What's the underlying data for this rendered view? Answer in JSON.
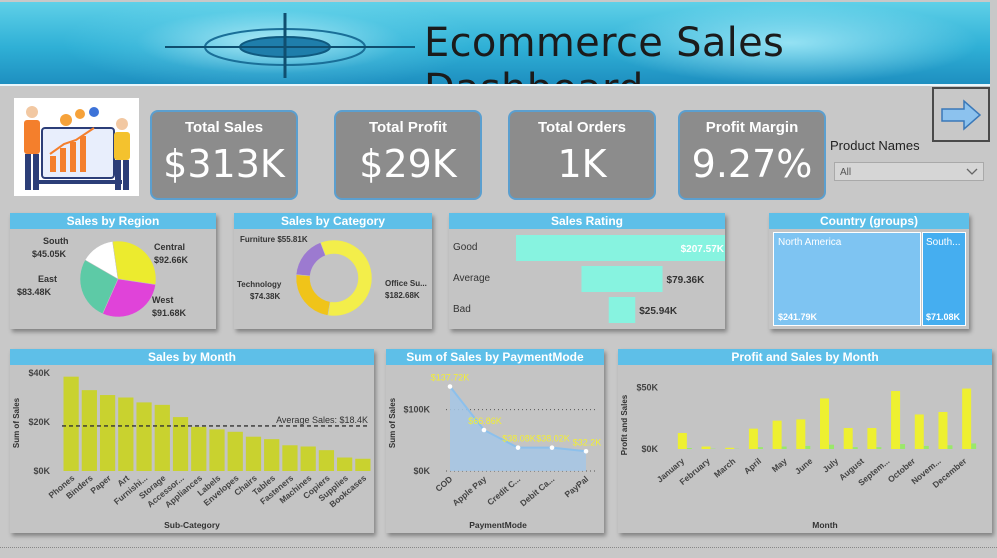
{
  "header": {
    "title": "Ecommerce Sales Dashboard"
  },
  "kpis": [
    {
      "label": "Total Sales",
      "value": "$313K"
    },
    {
      "label": "Total Profit",
      "value": "$29K"
    },
    {
      "label": "Total Orders",
      "value": "1K"
    },
    {
      "label": "Profit Margin",
      "value": "9.27%"
    }
  ],
  "filter": {
    "title": "Product Names",
    "value": "All"
  },
  "colors": {
    "accent": "#5ebfe8",
    "kpi_bg": "#8c8c8c",
    "bar_yellow": "#eef030",
    "bar_olive": "#c9d22f",
    "teal": "#87f3e0"
  },
  "region_chart": {
    "title": "Sales by Region",
    "slices": [
      {
        "name": "South",
        "value_label": "$45.05K",
        "value": 45.05,
        "color": "#ffffff"
      },
      {
        "name": "Central",
        "value_label": "$92.66K",
        "value": 92.66,
        "color": "#eceb2e"
      },
      {
        "name": "West",
        "value_label": "$91.68K",
        "value": 91.68,
        "color": "#e043d9"
      },
      {
        "name": "East",
        "value_label": "$83.48K",
        "value": 83.48,
        "color": "#5dcaa6"
      }
    ]
  },
  "category_chart": {
    "title": "Sales by Category",
    "slices": [
      {
        "name": "Furniture",
        "value_label": "$55.81K",
        "value": 55.81,
        "color": "#9c7ad0"
      },
      {
        "name": "Office Su...",
        "value_label": "$182.68K",
        "value": 182.68,
        "color": "#f3ee4a"
      },
      {
        "name": "Technology",
        "value_label": "$74.38K",
        "value": 74.38,
        "color": "#f0c419"
      }
    ]
  },
  "rating_chart": {
    "title": "Sales Rating",
    "rows": [
      {
        "name": "Good",
        "value": 207.57,
        "value_label": "$207.57K"
      },
      {
        "name": "Average",
        "value": 79.36,
        "value_label": "$79.36K"
      },
      {
        "name": "Bad",
        "value": 25.94,
        "value_label": "$25.94K"
      }
    ]
  },
  "country_chart": {
    "title": "Country (groups)",
    "tiles": [
      {
        "name": "North America",
        "value_label": "$241.79K",
        "value": 241.79,
        "color": "#7ec4f2"
      },
      {
        "name": "South...",
        "value_label": "$71.08K",
        "value": 71.08,
        "color": "#45aef0"
      }
    ]
  },
  "chart_data": [
    {
      "type": "bar",
      "title": "Sales by Month",
      "xlabel": "Sub-Category",
      "ylabel": "Sum of Sales",
      "ylim": [
        0,
        40000
      ],
      "yticks": [
        "$0K",
        "$20K",
        "$40K"
      ],
      "reference_line": {
        "label": "Average Sales: $18.4K",
        "value": 18400
      },
      "categories": [
        "Phones",
        "Binders",
        "Paper",
        "Art",
        "Furnishi...",
        "Storage",
        "Accessor...",
        "Appliances",
        "Labels",
        "Envelopes",
        "Chairs",
        "Tables",
        "Fasteners",
        "Machines",
        "Copiers",
        "Supplies",
        "Bookcases"
      ],
      "values": [
        38500,
        33000,
        31000,
        30000,
        28000,
        27000,
        22000,
        18000,
        17000,
        16000,
        14000,
        13000,
        10500,
        10000,
        8500,
        5500,
        5000
      ]
    },
    {
      "type": "area",
      "title": "Sum of Sales by PaymentMode",
      "xlabel": "PaymentMode",
      "ylabel": "Sum of Sales",
      "ylim": [
        0,
        150000
      ],
      "yticks": [
        "$0K",
        "$100K"
      ],
      "categories": [
        "COD",
        "Apple Pay",
        "Credit C...",
        "Debit Ca...",
        "PayPal"
      ],
      "values": [
        137720,
        66860,
        38080,
        38020,
        32200
      ],
      "value_labels": [
        "$137.72K",
        "$66.86K",
        "$38.08K",
        "$38.02K",
        "$32.2K"
      ]
    },
    {
      "type": "bar",
      "title": "Profit and Sales by Month",
      "xlabel": "Month",
      "ylabel": "Profit and Sales",
      "ylim": [
        0,
        60000
      ],
      "yticks": [
        "$0K",
        "$50K"
      ],
      "categories": [
        "January",
        "February",
        "March",
        "April",
        "May",
        "June",
        "July",
        "August",
        "Septem...",
        "October",
        "Novem...",
        "December"
      ],
      "series": [
        {
          "values": [
            13000,
            2000,
            1000,
            16500,
            23000,
            24000,
            41000,
            17000,
            17000,
            47000,
            28000,
            30000,
            49000
          ]
        },
        {
          "values": [
            800,
            300,
            200,
            1500,
            2000,
            2500,
            3500,
            1500,
            1500,
            4000,
            2500,
            3000,
            4500
          ]
        }
      ]
    }
  ]
}
